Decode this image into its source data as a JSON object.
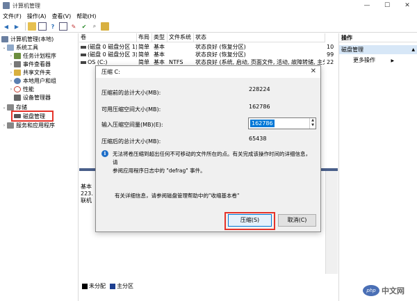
{
  "window": {
    "title": "计算机管理"
  },
  "menu": [
    "文件(F)",
    "操作(A)",
    "查看(V)",
    "帮助(H)"
  ],
  "tree": {
    "items": [
      {
        "label": "计算机管理(本地)",
        "level": 0,
        "twisty": "",
        "color": "#6a7fa0"
      },
      {
        "label": "系统工具",
        "level": 1,
        "twisty": "⌄",
        "color": "#8fa8c8"
      },
      {
        "label": "任务计划程序",
        "level": 2,
        "twisty": "›",
        "color": "#6b8e3e"
      },
      {
        "label": "事件查看器",
        "level": 2,
        "twisty": "›",
        "color": "#777777"
      },
      {
        "label": "共享文件夹",
        "level": 2,
        "twisty": "›",
        "color": "#d8b040"
      },
      {
        "label": "本地用户和组",
        "level": 2,
        "twisty": "›",
        "color": "#5b7fb0"
      },
      {
        "label": "性能",
        "level": 2,
        "twisty": "›",
        "color": "#c0392b"
      },
      {
        "label": "设备管理器",
        "level": 2,
        "twisty": "",
        "color": "#666666"
      },
      {
        "label": "存储",
        "level": 1,
        "twisty": "⌄",
        "color": "#888888"
      },
      {
        "label": "磁盘管理",
        "level": 2,
        "twisty": "",
        "color": "#555555"
      },
      {
        "label": "服务和应用程序",
        "level": 1,
        "twisty": "›",
        "color": "#888888"
      }
    ]
  },
  "volumes": {
    "headers": [
      "卷",
      "布局",
      "类型",
      "文件系统",
      "状态"
    ],
    "rows": [
      [
        "(磁盘 0 磁盘分区 1)",
        "简单",
        "基本",
        "",
        "状态良好 (恢复分区)"
      ],
      [
        "(磁盘 0 磁盘分区 3)",
        "简单",
        "基本",
        "",
        "状态良好 (恢复分区)"
      ],
      [
        "OS (C:)",
        "简单",
        "基本",
        "NTFS",
        "状态良好 (系统, 启动, 页面文件, 活动, 故障转储, 主分区)"
      ]
    ],
    "extra_col": [
      "10",
      "99",
      "22"
    ]
  },
  "lower_disk": {
    "lines": [
      "基本",
      "223.",
      "联机"
    ]
  },
  "legend": {
    "unallocated": "未分配",
    "primary": "主分区"
  },
  "actions": {
    "header": "操作",
    "selected": "磁盘管理",
    "more": "更多操作"
  },
  "dialog": {
    "title": "压缩 C:",
    "total_before_label": "压缩前的总计大小(MB):",
    "total_before": "228224",
    "available_label": "可用压缩空间大小(MB):",
    "available": "162786",
    "input_label": "输入压缩空间量(MB)(E):",
    "input_value": "162786",
    "total_after_label": "压缩后的总计大小(MB):",
    "total_after": "65438",
    "info_line1": "无法将卷压缩到超出任何不可移动的文件所在的点。有关完成该操作时间的详细信息，请",
    "info_line2": "参阅应用程序日志中的 \"defrag\" 事件。",
    "help": "有关详细信息，请参阅磁盘管理帮助中的\"收缩基本卷\"",
    "shrink_button": "压缩(S)",
    "cancel_button": "取消(C)"
  },
  "watermark": {
    "logo": "php",
    "text": "中文网"
  }
}
